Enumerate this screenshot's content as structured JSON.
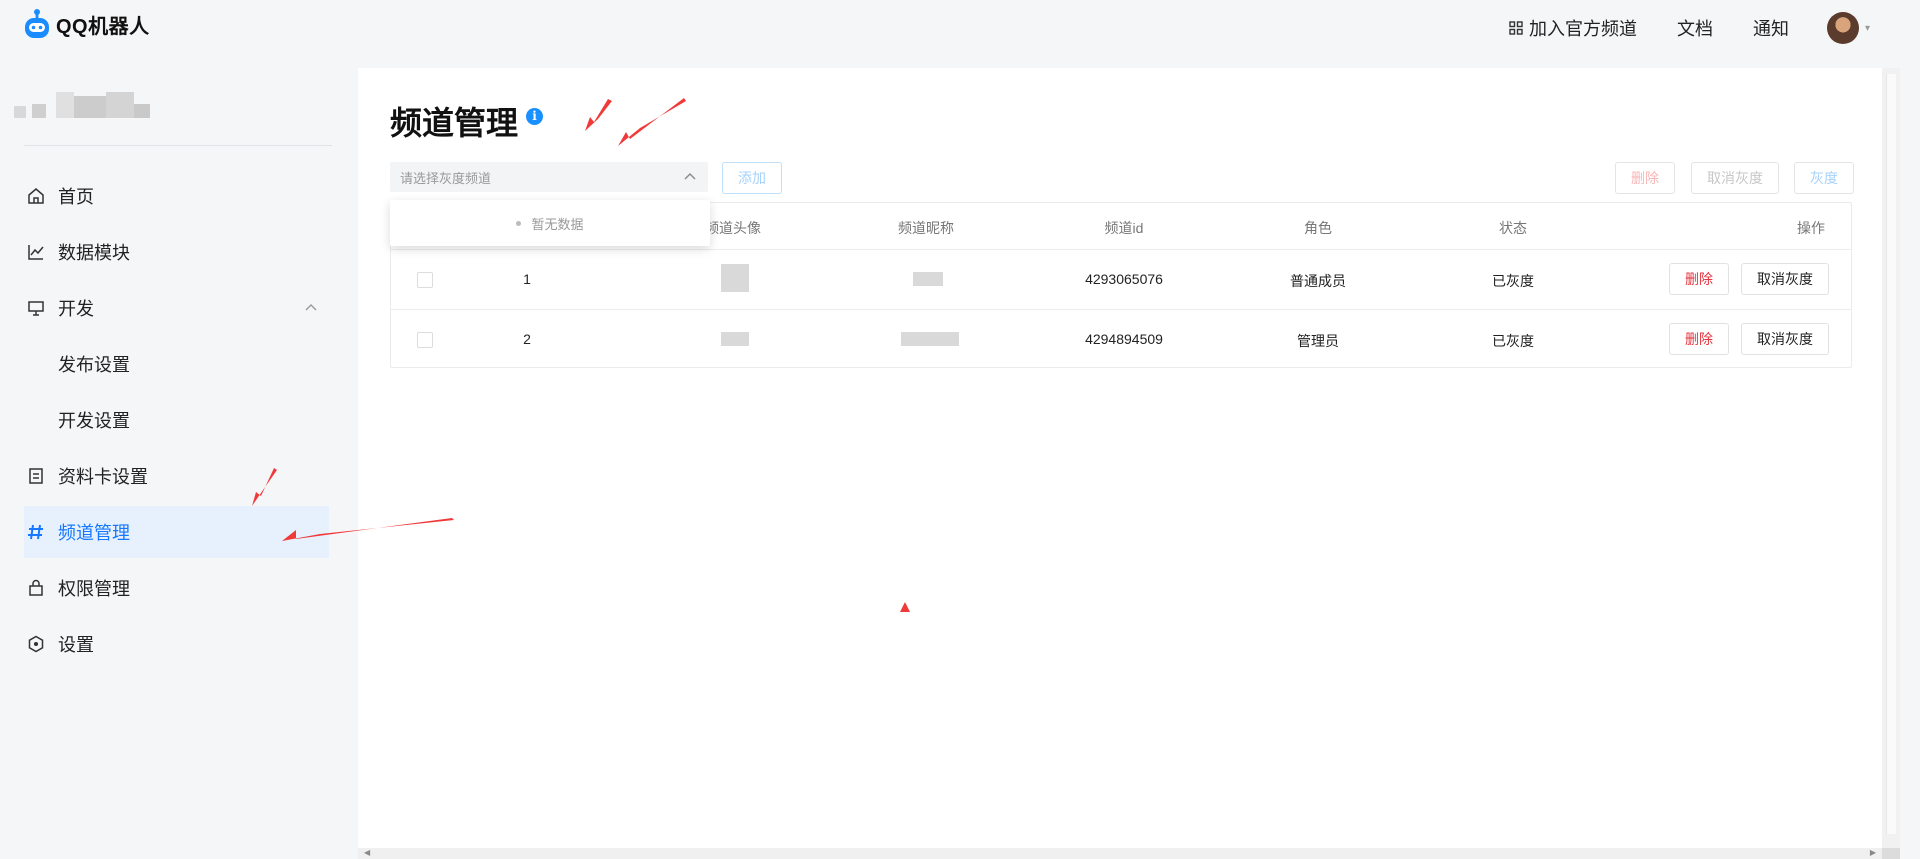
{
  "header": {
    "logo_text": "QQ机器人",
    "nav": [
      {
        "label": "加入官方频道",
        "icon": "grid-icon"
      },
      {
        "label": "文档"
      },
      {
        "label": "通知"
      }
    ],
    "avatar_caret": "▾"
  },
  "sidebar": {
    "items": [
      {
        "label": "首页",
        "icon": "home-icon"
      },
      {
        "label": "数据模块",
        "icon": "chart-line-icon"
      },
      {
        "label": "开发",
        "icon": "monitor-icon",
        "expanded": true
      },
      {
        "label": "发布设置",
        "sub": true
      },
      {
        "label": "开发设置",
        "sub": true
      },
      {
        "label": "资料卡设置",
        "icon": "card-icon"
      },
      {
        "label": "频道管理",
        "icon": "hash-icon",
        "active": true
      },
      {
        "label": "权限管理",
        "icon": "lock-icon"
      },
      {
        "label": "设置",
        "icon": "hexagon-icon"
      }
    ]
  },
  "main": {
    "title": "频道管理",
    "info_icon_glyph": "i",
    "select_placeholder": "请选择灰度频道",
    "add_label": "添加",
    "delete_label": "删除",
    "cancel_gray_label": "取消灰度",
    "gray_label": "灰度",
    "dropdown_empty": "暂无数据",
    "columns": [
      "频道头像",
      "频道昵称",
      "频道id",
      "角色",
      "状态",
      "操作"
    ],
    "rows": [
      {
        "index": "1",
        "channel_id": "4293065076",
        "role": "普通成员",
        "status": "已灰度",
        "delete": "删除",
        "cancel": "取消灰度"
      },
      {
        "index": "2",
        "channel_id": "4294894509",
        "role": "管理员",
        "status": "已灰度",
        "delete": "删除",
        "cancel": "取消灰度"
      }
    ]
  },
  "colors": {
    "accent": "#1677ff",
    "active_bg": "#e6f1fd",
    "danger": "#e5343f",
    "annotation": "#f03a3a"
  }
}
